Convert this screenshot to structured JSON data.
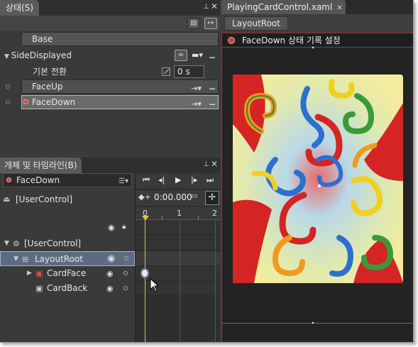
{
  "states_panel": {
    "title": "상태(S)",
    "base_label": "Base",
    "group_name": "SideDisplayed",
    "default_transition_label": "기본 전환",
    "default_transition_value": "0 s",
    "states": [
      {
        "name": "FaceUp",
        "selected": false
      },
      {
        "name": "FaceDown",
        "selected": true
      }
    ]
  },
  "objects_panel": {
    "title": "개체 및 타임라인(B)",
    "current_state": "FaceDown",
    "scope": "[UserControl]",
    "tree": [
      {
        "label": "[UserControl]"
      },
      {
        "label": "LayoutRoot"
      },
      {
        "label": "CardFace"
      },
      {
        "label": "CardBack"
      }
    ]
  },
  "timeline": {
    "time": "0:00.000",
    "ruler_labels": [
      "0",
      "1",
      "2"
    ]
  },
  "document": {
    "tab_title": "PlayingCardControl.xaml",
    "breadcrumb": "LayoutRoot",
    "recording_label": "FaceDown 상태 기록 설정"
  },
  "colors": {
    "record_red": "#c02020",
    "playhead": "#e8c040",
    "selection": "#5d6b82"
  }
}
